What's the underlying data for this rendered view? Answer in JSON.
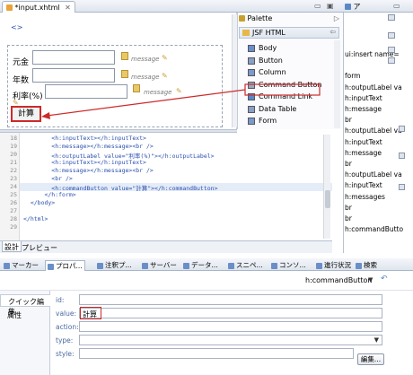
{
  "editor": {
    "tab_title": "*input.xhtml",
    "tag_marker": "<>",
    "form_rows": [
      {
        "label": "元金",
        "message": "message"
      },
      {
        "label": "年数",
        "message": "message"
      },
      {
        "label": "利率(%)",
        "message": "message"
      }
    ],
    "submit_label": "計算",
    "code_lines": [
      {
        "num": "18",
        "text": "        <h:inputText></h:inputText>"
      },
      {
        "num": "19",
        "text": "        <h:message></h:message><br />"
      },
      {
        "num": "20",
        "text": "        <h:outputLabel value=\"利率(%)\"></h:outputLabel>"
      },
      {
        "num": "21",
        "text": "        <h:inputText></h:inputText>"
      },
      {
        "num": "22",
        "text": "        <h:message></h:message><br />"
      },
      {
        "num": "23",
        "text": "        <br />"
      },
      {
        "num": "24",
        "text": "        <h:commandButton value=\"計算\"></h:commandButton>"
      },
      {
        "num": "25",
        "text": "      </h:form>"
      },
      {
        "num": "26",
        "text": "  </body>"
      },
      {
        "num": "27",
        "text": ""
      },
      {
        "num": "28",
        "text": "</html>"
      },
      {
        "num": "29",
        "text": ""
      }
    ],
    "bottom_tabs": [
      "設計",
      "プレビュー"
    ]
  },
  "palette": {
    "title": "Palette",
    "group": "JSF HTML",
    "items": [
      "Body",
      "Button",
      "Column",
      "Command Button",
      "Command Link",
      "Data Table",
      "Form"
    ]
  },
  "outline": {
    "tab_label": "ア",
    "lines": [
      "ui:insert name=",
      "",
      "form",
      "h:outputLabel va",
      "h:inputText",
      "h:message",
      "br",
      "h:outputLabel va",
      "h:inputText",
      "h:message",
      "br",
      "h:outputLabel va",
      "h:inputText",
      "h:messages",
      "br",
      "br",
      "h:commandButto"
    ]
  },
  "views": {
    "tabs": [
      "マーカー",
      "プロパ...",
      "注釈プ...",
      "サーバー",
      "データ...",
      "スニペ...",
      "コンソ...",
      "進行状況",
      "検索"
    ]
  },
  "properties": {
    "element_title": "h:commandButton",
    "side_tabs": [
      "クイック編集",
      "属性"
    ],
    "fields": [
      {
        "label": "id:",
        "value": ""
      },
      {
        "label": "value:",
        "value": "計算"
      },
      {
        "label": "action:",
        "value": ""
      },
      {
        "label": "type:",
        "value": ""
      },
      {
        "label": "style:",
        "value": ""
      }
    ],
    "edit_button": "編集..."
  },
  "colors": {
    "highlight": "#cc2a2a",
    "code_blue": "#2a4fb0",
    "tab_border": "#a9b6c8"
  }
}
